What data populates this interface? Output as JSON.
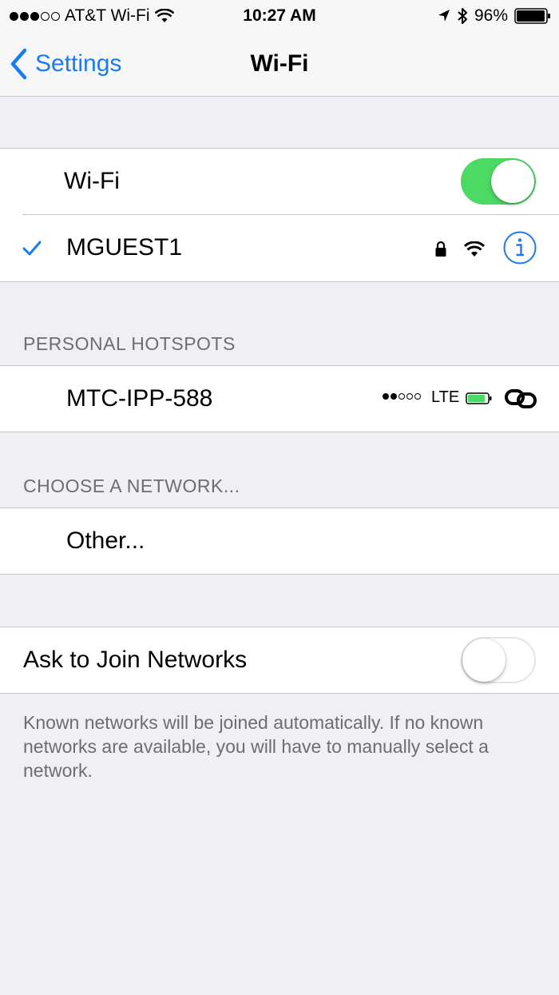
{
  "status_bar": {
    "signal_filled": 3,
    "signal_total": 5,
    "carrier": "AT&T Wi-Fi",
    "time": "10:27 AM",
    "battery_percent": "96%"
  },
  "nav": {
    "back_label": "Settings",
    "title": "Wi-Fi"
  },
  "wifi": {
    "label": "Wi-Fi",
    "enabled": true,
    "connected_network": "MGUEST1"
  },
  "personal_hotspots": {
    "header": "PERSONAL HOTSPOTS",
    "items": [
      {
        "name": "MTC-IPP-588",
        "signal_filled": 2,
        "signal_total": 5,
        "network_type": "LTE"
      }
    ]
  },
  "choose_network": {
    "header": "CHOOSE A NETWORK...",
    "other_label": "Other..."
  },
  "ask_to_join": {
    "label": "Ask to Join Networks",
    "enabled": false,
    "footer": "Known networks will be joined automatically. If no known networks are available, you will have to manually select a network."
  },
  "colors": {
    "accent": "#1a7cf3",
    "toggle_on": "#4cd964",
    "background": "#efeff4"
  }
}
